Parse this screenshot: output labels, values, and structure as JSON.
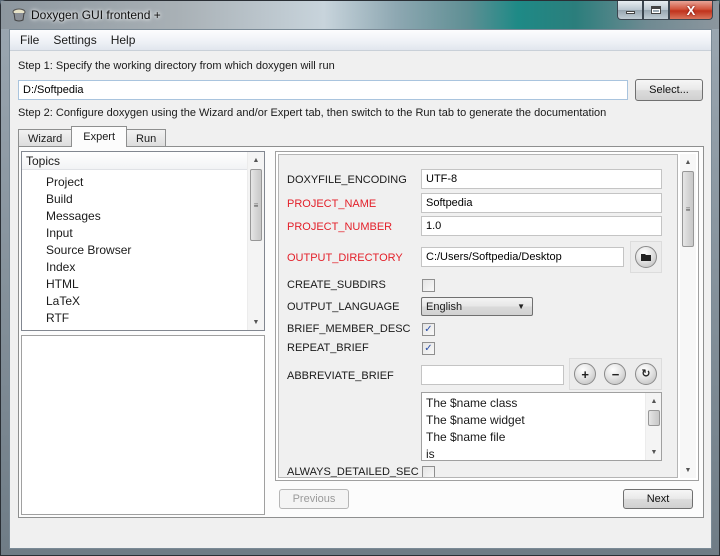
{
  "window": {
    "title": "Doxygen GUI frontend +",
    "caption_buttons": [
      "minimize",
      "maximize",
      "close"
    ],
    "close_glyph": "X"
  },
  "menubar": {
    "items": [
      "File",
      "Settings",
      "Help"
    ]
  },
  "step1": {
    "label": "Step 1: Specify the working directory from which doxygen will run",
    "working_directory": "D:/Softpedia",
    "select_button": "Select..."
  },
  "step2": {
    "label": "Step 2: Configure doxygen using the Wizard and/or Expert tab, then switch to the Run tab to generate the documentation"
  },
  "tabs": [
    {
      "label": "Wizard",
      "active": false
    },
    {
      "label": "Expert",
      "active": true
    },
    {
      "label": "Run",
      "active": false
    }
  ],
  "topics": {
    "header": "Topics",
    "items": [
      "Project",
      "Build",
      "Messages",
      "Input",
      "Source Browser",
      "Index",
      "HTML",
      "LaTeX",
      "RTF"
    ]
  },
  "options": {
    "colors": {
      "changed_label": "#e3202a",
      "default_label": "#1a1a1a",
      "check": "#2a4fa8"
    },
    "doxyfile_encoding": {
      "label": "DOXYFILE_ENCODING",
      "value": "UTF-8"
    },
    "project_name": {
      "label": "PROJECT_NAME",
      "value": "Softpedia"
    },
    "project_number": {
      "label": "PROJECT_NUMBER",
      "value": "1.0"
    },
    "output_directory": {
      "label": "OUTPUT_DIRECTORY",
      "value": "C:/Users/Softpedia/Desktop"
    },
    "create_subdirs": {
      "label": "CREATE_SUBDIRS",
      "checked": false
    },
    "output_language": {
      "label": "OUTPUT_LANGUAGE",
      "value": "English"
    },
    "brief_member_desc": {
      "label": "BRIEF_MEMBER_DESC",
      "checked": true
    },
    "repeat_brief": {
      "label": "REPEAT_BRIEF",
      "checked": true
    },
    "abbreviate_brief": {
      "label": "ABBREVIATE_BRIEF",
      "input_value": "",
      "list": [
        "The $name class",
        "The $name widget",
        "The $name file",
        "is"
      ]
    },
    "always_detailed_sec": {
      "label": "ALWAYS_DETAILED_SEC",
      "checked": false
    }
  },
  "icons": {
    "check": "✓",
    "plus": "+",
    "minus": "−",
    "refresh": "↻",
    "up": "▲",
    "down": "▼",
    "grip": "≡"
  },
  "navigation": {
    "previous": "Previous",
    "next": "Next"
  }
}
